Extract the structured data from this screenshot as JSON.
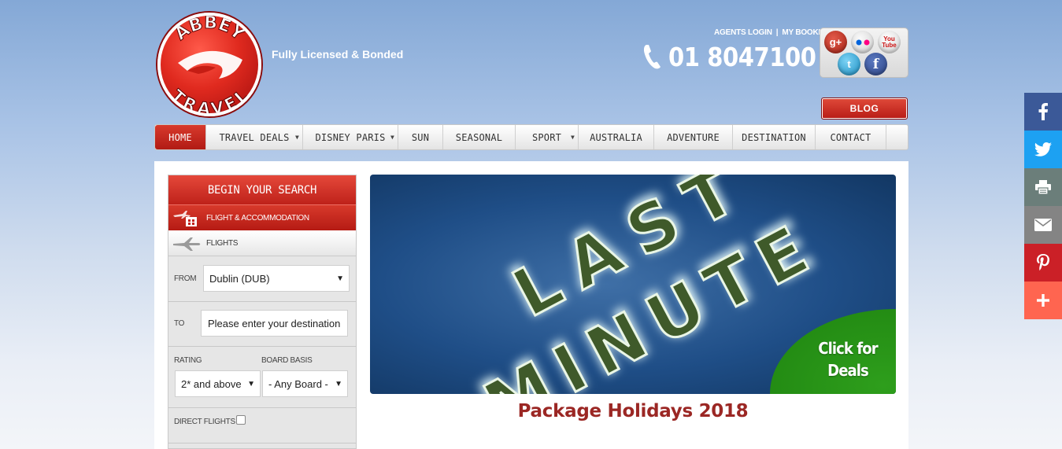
{
  "header": {
    "logo_text_top": "ABBEY",
    "logo_text_bottom": "TRAVEL",
    "tagline": "Fully Licensed & Bonded",
    "agents_login": "AGENTS LOGIN",
    "link_separator": "|",
    "my_booking": "MY BOOKING",
    "phone": "01 8047100",
    "social": {
      "google_plus": "g+",
      "flickr": "●●",
      "youtube": "You Tube",
      "twitter": "t",
      "facebook": "f"
    },
    "blog_label": "BLOG"
  },
  "nav": {
    "items": [
      {
        "label": "HOME",
        "active": true,
        "dropdown": false
      },
      {
        "label": "TRAVEL DEALS",
        "active": false,
        "dropdown": true
      },
      {
        "label": "DISNEY PARIS",
        "active": false,
        "dropdown": true
      },
      {
        "label": "SUN",
        "active": false,
        "dropdown": false
      },
      {
        "label": "SEASONAL",
        "active": false,
        "dropdown": false
      },
      {
        "label": "SPORT",
        "active": false,
        "dropdown": true
      },
      {
        "label": "AUSTRALIA",
        "active": false,
        "dropdown": false
      },
      {
        "label": "ADVENTURE",
        "active": false,
        "dropdown": false
      },
      {
        "label": "DESTINATION",
        "active": false,
        "dropdown": false
      },
      {
        "label": "CONTACT",
        "active": false,
        "dropdown": false
      }
    ],
    "dropdown_arrow": "▼"
  },
  "search": {
    "title": "BEGIN YOUR SEARCH",
    "tab_flight_accommodation": "FLIGHT & ACCOMMODATION",
    "tab_flights": "FLIGHTS",
    "from_label": "FROM",
    "from_value": "Dublin (DUB)",
    "to_label": "TO",
    "to_placeholder": "Please enter your destination",
    "rating_label": "RATING",
    "rating_value": "2* and above",
    "board_label": "BOARD BASIS",
    "board_value": "- Any Board -",
    "direct_label": "DIRECT FLIGHTS",
    "direct_checked": false,
    "caret": "▼"
  },
  "banner": {
    "headline_line1": "LAST",
    "headline_line2": "MINUTE",
    "cta_line1": "Click for",
    "cta_line2": "Deals"
  },
  "main": {
    "title": "Package Holidays 2018"
  },
  "share_bar": [
    {
      "icon": "facebook-icon",
      "color": "#3b5998"
    },
    {
      "icon": "twitter-icon",
      "color": "#1da1f2"
    },
    {
      "icon": "print-icon",
      "color": "#6b7e7a"
    },
    {
      "icon": "email-icon",
      "color": "#848484"
    },
    {
      "icon": "pinterest-icon",
      "color": "#cb2027"
    },
    {
      "icon": "plus-icon",
      "color": "#ff6550"
    }
  ]
}
